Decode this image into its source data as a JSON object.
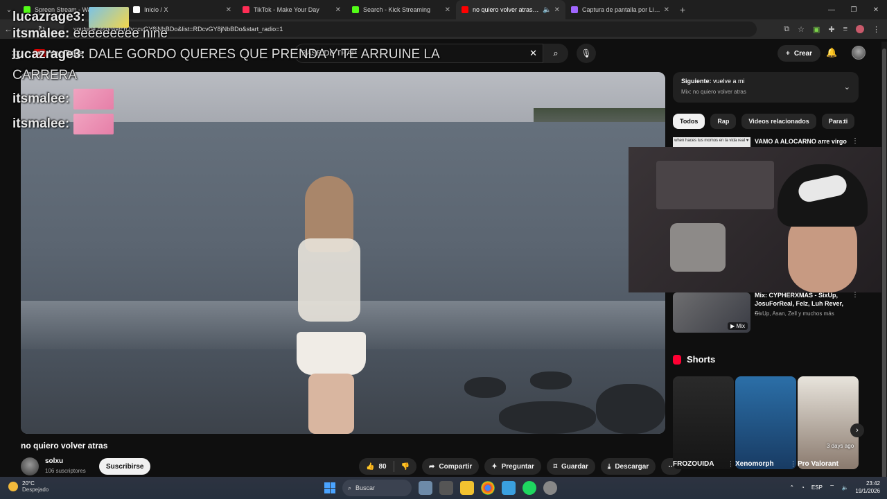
{
  "browser": {
    "tabs": [
      {
        "title": "Spreen Stream - Watch Live o",
        "favicon_color": "#53fc18",
        "active": false
      },
      {
        "title": "Inicio / X",
        "favicon_color": "#ffffff",
        "active": false
      },
      {
        "title": "TikTok - Make Your Day",
        "favicon_color": "#ff2d55",
        "active": false
      },
      {
        "title": "Search - Kick Streaming",
        "favicon_color": "#53fc18",
        "active": false
      },
      {
        "title": "no quiero volver atras - You",
        "favicon_color": "#ff0000",
        "active": true
      },
      {
        "title": "Captura de pantalla por Lights",
        "favicon_color": "#a066ff",
        "active": false
      }
    ],
    "url": "youtube.com/watch?v=cvGY8jNbBDo&list=RDcvGY8jNbBDo&start_radio=1"
  },
  "header": {
    "logo": "YouTube",
    "search_value": "BASE DE TRAP",
    "create_label": "Crear"
  },
  "chat": [
    {
      "user": "lucazrage3:",
      "message": ""
    },
    {
      "user": "itsmalee:",
      "message": "eeeeeeeee nine"
    },
    {
      "user": "lucazrage3:",
      "message": "DALE GORDO QUERES QUE PRENDA Y TE ARRUINE LA CARRERA"
    },
    {
      "user": "itsmalee:",
      "message": ""
    },
    {
      "user": "itsmalee:",
      "message": ""
    }
  ],
  "video": {
    "title": "no quiero volver atras",
    "channel": "solxu",
    "subscribers": "106 suscriptores",
    "subscribe_label": "Suscribirse",
    "likes": "80",
    "share_label": "Compartir",
    "ask_label": "Preguntar",
    "save_label": "Guardar",
    "download_label": "Descargar"
  },
  "sidebar": {
    "next_label": "Siguiente:",
    "next_title": "vuelve a mi",
    "next_mix": "Mix: no quiero volver atras",
    "chips": [
      "Todos",
      "Rap",
      "Videos relacionados",
      "Para ti"
    ],
    "rec1": {
      "thumb_text": "when haces tus momos en la vida real ♥",
      "title": "VAMO A ALOCARNO arre virgo"
    },
    "rec2": {
      "title": "Mix: CYPHERXMAS - SixUp, JosuForReal, Felz, Luh Rever, ...",
      "meta": "SixUp, Asan, Zell y muchos más",
      "badge": "Mix"
    },
    "shorts_heading": "Shorts",
    "shorts": [
      {
        "title": "FROZOUIDA",
        "badge": ""
      },
      {
        "title": "Xenomorph",
        "badge": ""
      },
      {
        "title": "Pro Valorant",
        "badge": "3 days ago"
      }
    ]
  },
  "taskbar": {
    "temperature": "20°C",
    "weather": "Despejado",
    "search_label": "Buscar",
    "language": "ESP",
    "time": "23:42",
    "date": "19/1/2026"
  }
}
